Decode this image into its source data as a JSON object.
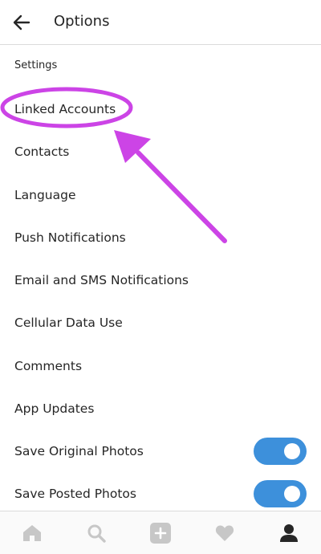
{
  "header": {
    "title": "Options",
    "back_icon": "arrow-left-icon"
  },
  "section": {
    "label": "Settings"
  },
  "settings": {
    "items": [
      {
        "label": "Linked Accounts",
        "highlighted": true
      },
      {
        "label": "Contacts"
      },
      {
        "label": "Language"
      },
      {
        "label": "Push Notifications"
      },
      {
        "label": "Email and SMS Notifications"
      },
      {
        "label": "Cellular Data Use"
      },
      {
        "label": "Comments"
      },
      {
        "label": "App Updates"
      },
      {
        "label": "Save Original Photos",
        "toggle": true,
        "enabled": true
      },
      {
        "label": "Save Posted Photos",
        "toggle": true,
        "enabled": true
      }
    ]
  },
  "annotation": {
    "color": "#cc44e6",
    "shapes": [
      "highlight-ellipse",
      "pointer-arrow"
    ]
  },
  "bottom_nav": {
    "tabs": [
      {
        "icon": "home-icon",
        "active": false
      },
      {
        "icon": "search-icon",
        "active": false
      },
      {
        "icon": "plus-square-icon",
        "active": false
      },
      {
        "icon": "heart-icon",
        "active": false
      },
      {
        "icon": "profile-icon",
        "active": true
      }
    ]
  },
  "colors": {
    "toggle_on": "#3d90db",
    "text": "#262626",
    "inactive_icon": "#c7c7c7",
    "active_icon": "#262626"
  }
}
